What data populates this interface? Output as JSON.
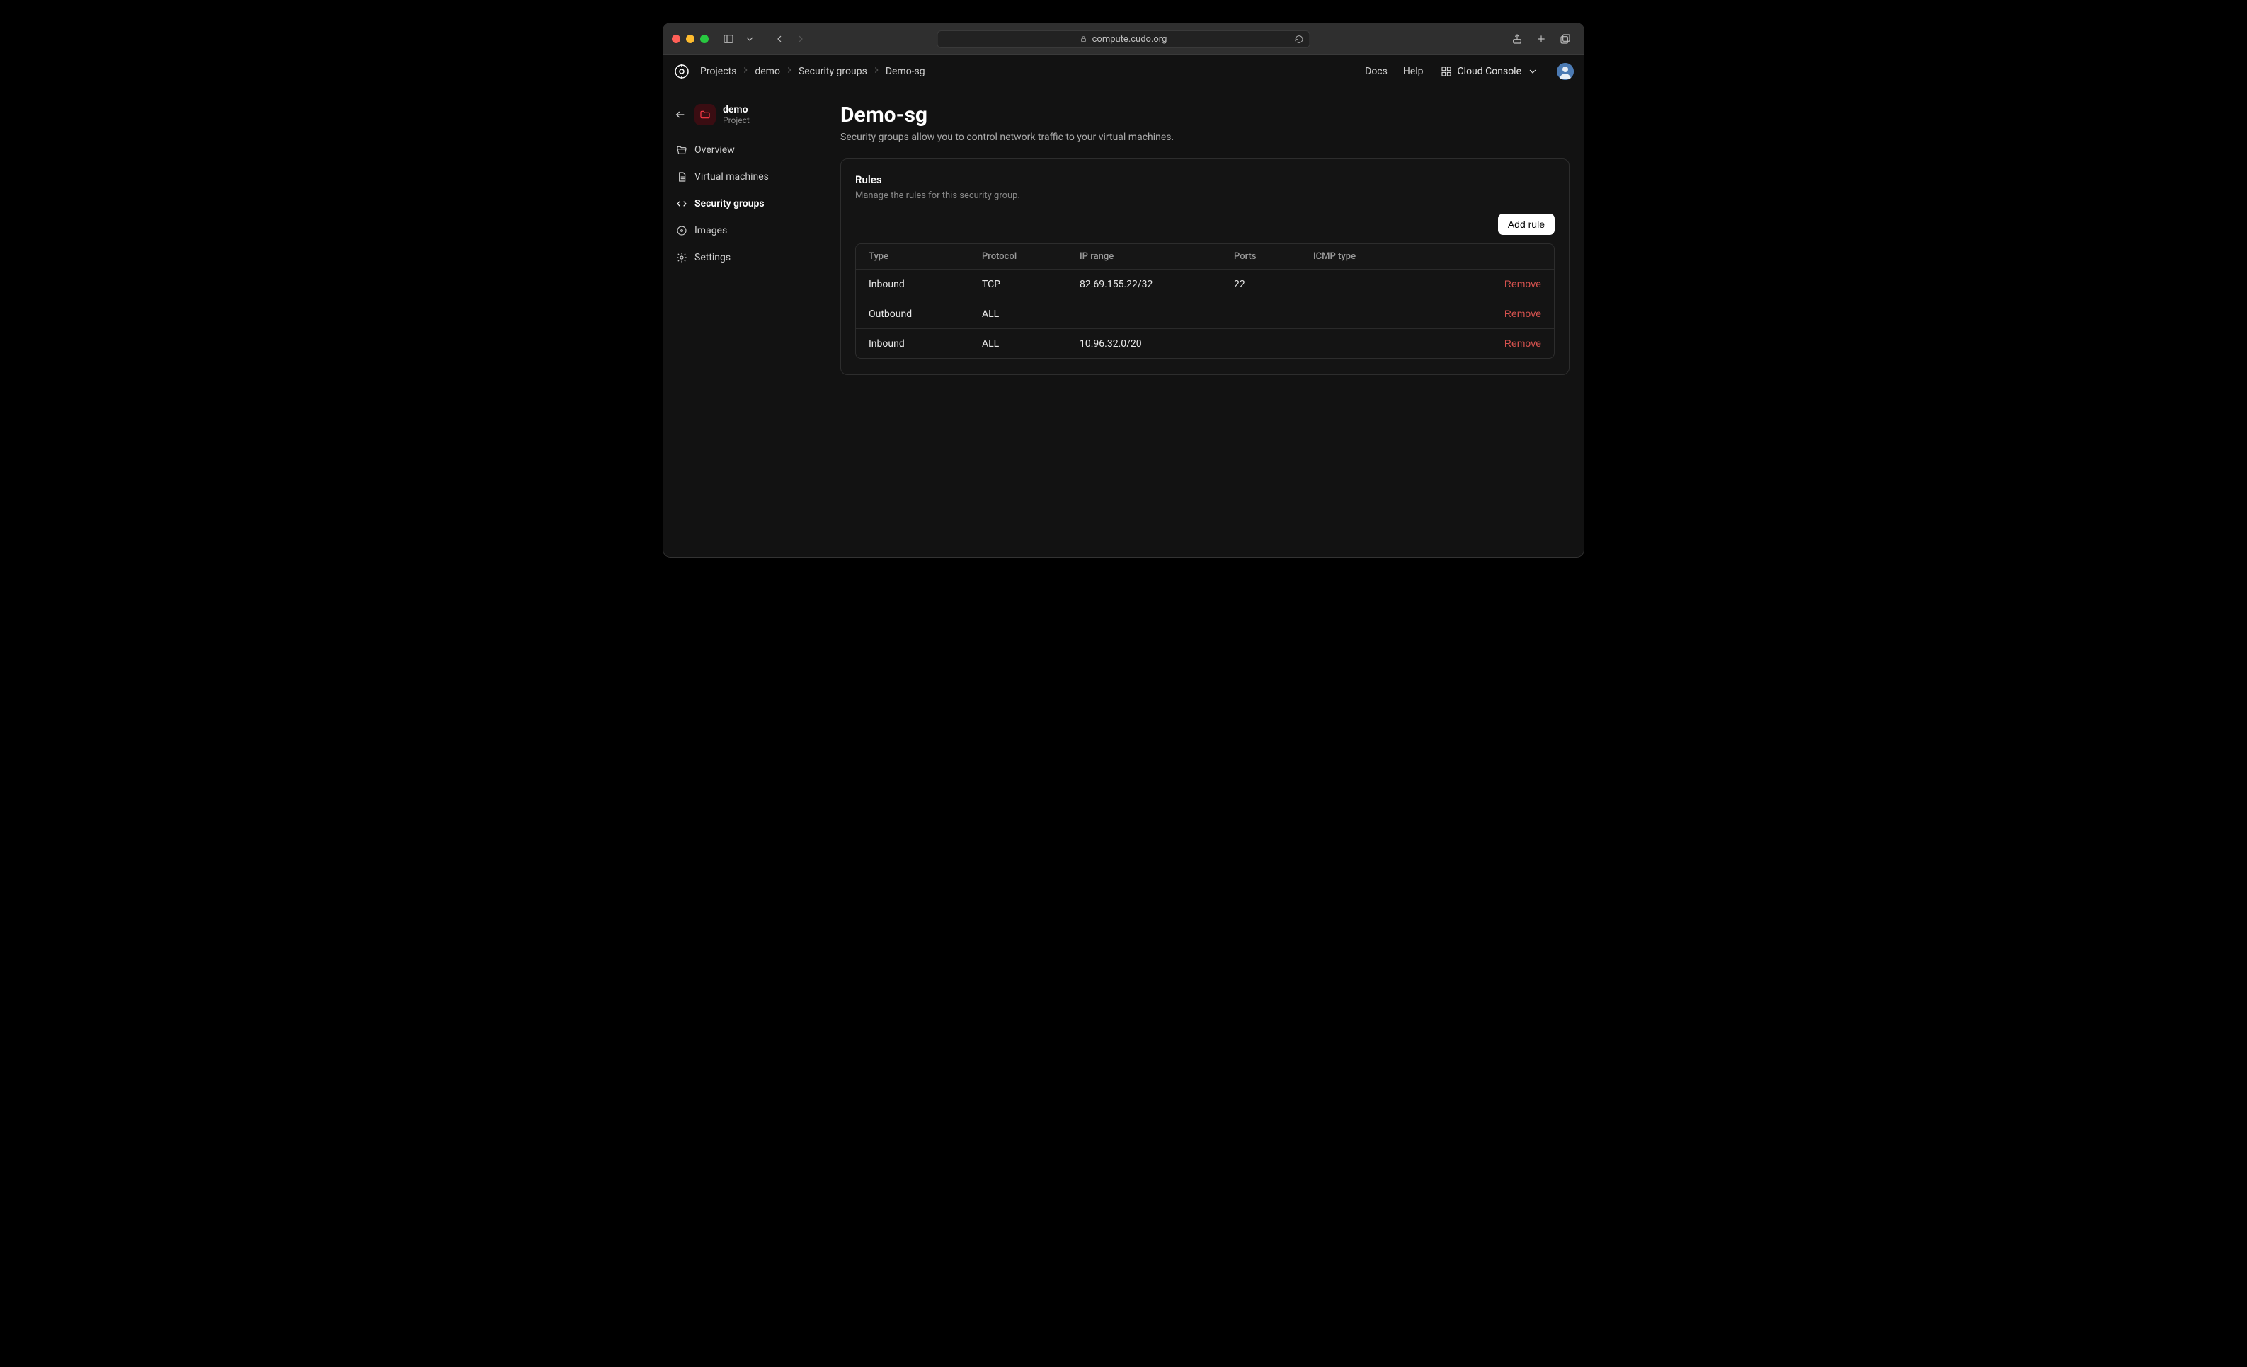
{
  "browser": {
    "url": "compute.cudo.org"
  },
  "appbar": {
    "breadcrumbs": [
      "Projects",
      "demo",
      "Security groups",
      "Demo-sg"
    ],
    "docs": "Docs",
    "help": "Help",
    "console": "Cloud Console"
  },
  "sidebar": {
    "project": {
      "name": "demo",
      "sub": "Project"
    },
    "items": [
      {
        "label": "Overview"
      },
      {
        "label": "Virtual machines"
      },
      {
        "label": "Security groups"
      },
      {
        "label": "Images"
      },
      {
        "label": "Settings"
      }
    ]
  },
  "page": {
    "title": "Demo-sg",
    "subtitle": "Security groups allow you to control network traffic to your virtual machines."
  },
  "rules_card": {
    "heading": "Rules",
    "desc": "Manage the rules for this security group.",
    "add_btn": "Add rule",
    "remove": "Remove",
    "columns": {
      "type": "Type",
      "protocol": "Protocol",
      "ip": "IP range",
      "ports": "Ports",
      "icmp": "ICMP type"
    },
    "rows": [
      {
        "type": "Inbound",
        "protocol": "TCP",
        "ip": "82.69.155.22/32",
        "ports": "22",
        "icmp": ""
      },
      {
        "type": "Outbound",
        "protocol": "ALL",
        "ip": "",
        "ports": "",
        "icmp": ""
      },
      {
        "type": "Inbound",
        "protocol": "ALL",
        "ip": "10.96.32.0/20",
        "ports": "",
        "icmp": ""
      }
    ]
  }
}
